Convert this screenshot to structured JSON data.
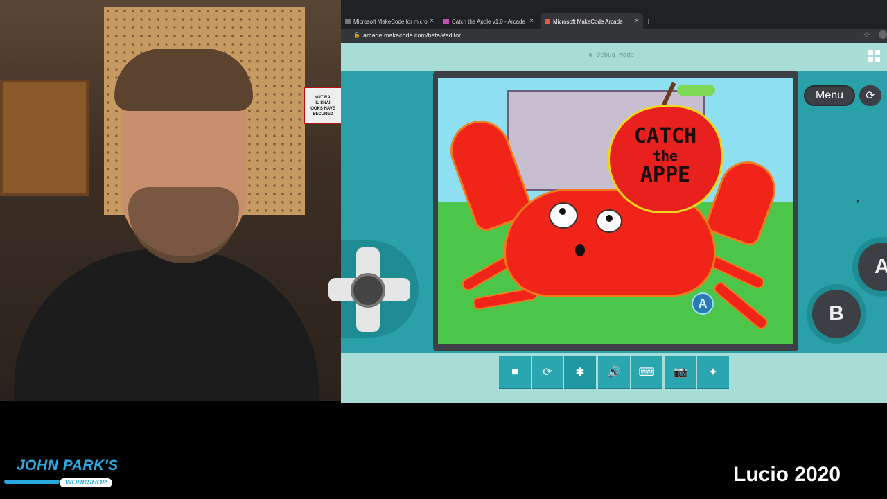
{
  "browser": {
    "tabs": [
      {
        "label": "Microsoft MakeCode for micro",
        "favicon_color": "#777777",
        "close": "×"
      },
      {
        "label": "Catch the Apple v1.0 - Arcade",
        "favicon_color": "#c84fb5",
        "close": "×"
      },
      {
        "label": "Microsoft MakeCode Arcade",
        "favicon_color": "#e05a48",
        "close": "×"
      }
    ],
    "new_tab": "+",
    "url": "arcade.makecode.com/beta/#editor",
    "lock_icon": "🔒",
    "star_icon": "☆"
  },
  "arcade": {
    "debug_label": "Debug Mode",
    "menu_label": "Menu",
    "reload_icon": "⟳",
    "button_b": "B",
    "button_a": "A",
    "game_title_line1": "CATCH",
    "game_title_line2": "the",
    "game_title_line3": "APPE",
    "a_marker": "A",
    "toolbar": [
      {
        "name": "stop-icon",
        "glyph": "■"
      },
      {
        "name": "restart-icon",
        "glyph": "⟳"
      },
      {
        "name": "debug-icon",
        "glyph": "✱"
      },
      {
        "name": "sound-icon",
        "glyph": "🔊"
      },
      {
        "name": "keyboard-icon",
        "glyph": "⌨"
      },
      {
        "name": "screenshot-icon",
        "glyph": "📷"
      },
      {
        "name": "fullscreen-icon",
        "glyph": "✦"
      }
    ]
  },
  "overlay": {
    "brand_title": "JOHN PARK'S",
    "brand_sub": "WORKSHOP",
    "credit": "Lucio 2020"
  },
  "colors": {
    "arcade_teal": "#2aa0a8",
    "arcade_light": "#a8dcd6",
    "brand_blue": "#2aa9e0"
  }
}
